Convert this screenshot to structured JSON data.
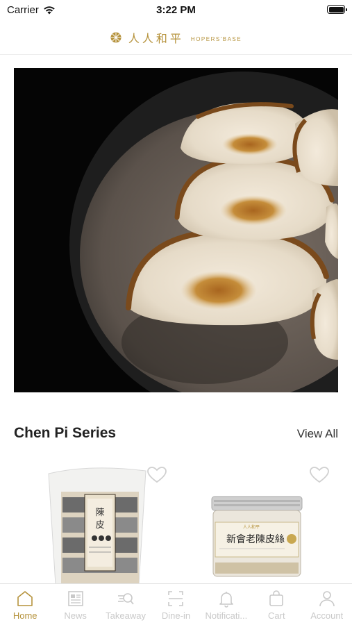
{
  "status_bar": {
    "carrier": "Carrier",
    "time": "3:22 PM"
  },
  "header": {
    "brand_cn": "人人和平",
    "brand_en": "HOPERS'BASE",
    "accent_color": "#b5923b"
  },
  "banner": {
    "slide_count": 3,
    "active_slide": 1
  },
  "section": {
    "title": "Chen Pi Series",
    "view_all": "View All"
  },
  "products": [
    {
      "id": "product-1",
      "image": "chen-pi-pouch",
      "label_text": "陳皮"
    },
    {
      "id": "product-2",
      "image": "chen-pi-jar",
      "label_text": "新會老陳皮絲"
    }
  ],
  "tabs": [
    {
      "label": "Home",
      "icon": "home-icon",
      "active": true
    },
    {
      "label": "News",
      "icon": "news-icon",
      "active": false
    },
    {
      "label": "Takeaway",
      "icon": "takeaway-icon",
      "active": false
    },
    {
      "label": "Dine-in",
      "icon": "dine-in-icon",
      "active": false
    },
    {
      "label": "Notificati...",
      "icon": "bell-icon",
      "active": false
    },
    {
      "label": "Cart",
      "icon": "cart-icon",
      "active": false
    },
    {
      "label": "Account",
      "icon": "account-icon",
      "active": false
    }
  ]
}
